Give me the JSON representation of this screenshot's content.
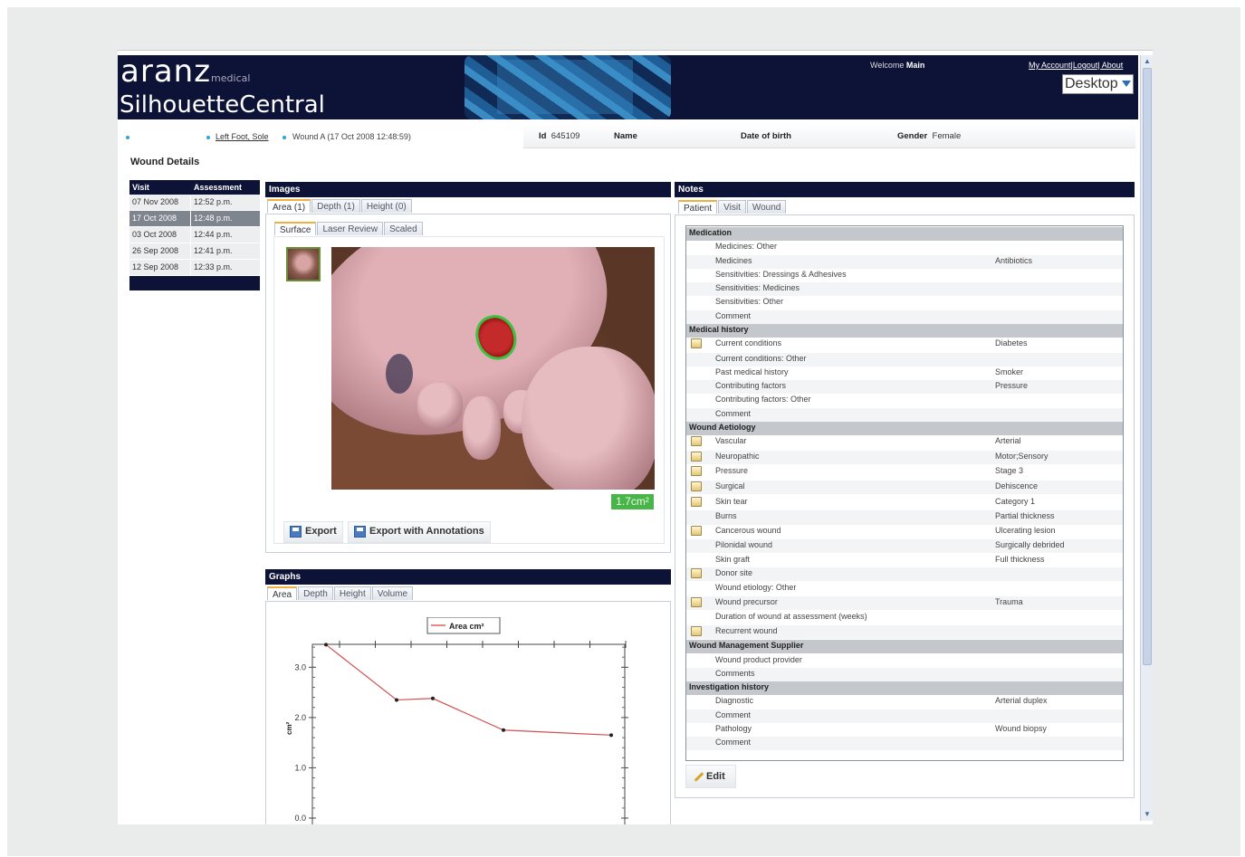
{
  "header": {
    "logo_main": "aranz",
    "logo_sub": "medical",
    "product": "SilhouetteCentral",
    "welcome_prefix": "Welcome",
    "welcome_user": "Main",
    "top_links": "My Account|Logout| About",
    "workspace_select": "Desktop"
  },
  "breadcrumb": {
    "link": "Left Foot, Sole",
    "current": "Wound A (17 Oct 2008 12:48:59)"
  },
  "patient": {
    "id_label": "Id",
    "id_value": "645109",
    "name_label": "Name",
    "name_value": "",
    "dob_label": "Date of birth",
    "dob_value": "",
    "gender_label": "Gender",
    "gender_value": "Female"
  },
  "page_title": "Wound Details",
  "visits": {
    "col_visit": "Visit",
    "col_assessment": "Assessment",
    "rows": [
      {
        "visit": "07 Nov 2008",
        "assessment": "12:52 p.m."
      },
      {
        "visit": "17 Oct 2008",
        "assessment": "12:48 p.m."
      },
      {
        "visit": "03 Oct 2008",
        "assessment": "12:44 p.m."
      },
      {
        "visit": "26 Sep 2008",
        "assessment": "12:41 p.m."
      },
      {
        "visit": "12 Sep 2008",
        "assessment": "12:33 p.m."
      }
    ],
    "selected_index": 1
  },
  "images": {
    "title": "Images",
    "tabs": [
      "Area (1)",
      "Depth (1)",
      "Height (0)"
    ],
    "subtabs": [
      "Surface",
      "Laser Review",
      "Scaled"
    ],
    "area_badge": "1.7cm²",
    "export_label": "Export",
    "export_annotations_label": "Export with Annotations"
  },
  "graphs": {
    "title": "Graphs",
    "tabs": [
      "Area",
      "Depth",
      "Height",
      "Volume"
    ]
  },
  "chart_data": {
    "type": "line",
    "legend": "Area cm²",
    "ylabel": "cm²",
    "x_index": [
      0,
      1,
      2,
      3,
      4
    ],
    "values": [
      3.45,
      2.35,
      2.38,
      1.75,
      1.65
    ],
    "yticks": [
      "0.0",
      "1.0",
      "2.0",
      "3.0"
    ],
    "ylim": [
      0,
      3.6
    ]
  },
  "notes": {
    "title": "Notes",
    "tabs": [
      "Patient",
      "Visit",
      "Wound"
    ],
    "edit_label": "Edit",
    "rows": [
      {
        "section": "Medication"
      },
      {
        "label": "Medicines: Other",
        "value": "",
        "icon": false
      },
      {
        "label": "Medicines",
        "value": "Antibiotics",
        "icon": false
      },
      {
        "label": "Sensitivities: Dressings & Adhesives",
        "value": "",
        "icon": false
      },
      {
        "label": "Sensitivities: Medicines",
        "value": "",
        "icon": false
      },
      {
        "label": "Sensitivities: Other",
        "value": "",
        "icon": false
      },
      {
        "label": "Comment",
        "value": "",
        "icon": false
      },
      {
        "section": "Medical history"
      },
      {
        "label": "Current conditions",
        "value": "Diabetes",
        "icon": true
      },
      {
        "label": "Current conditions: Other",
        "value": "",
        "icon": false
      },
      {
        "label": "Past medical history",
        "value": "Smoker",
        "icon": false
      },
      {
        "label": "Contributing factors",
        "value": "Pressure",
        "icon": false
      },
      {
        "label": "Contributing factors: Other",
        "value": "",
        "icon": false
      },
      {
        "label": "Comment",
        "value": "",
        "icon": false
      },
      {
        "section": "Wound Aetiology"
      },
      {
        "label": "Vascular",
        "value": "Arterial",
        "icon": true
      },
      {
        "label": "Neuropathic",
        "value": "Motor;Sensory",
        "icon": true
      },
      {
        "label": "Pressure",
        "value": "Stage 3",
        "icon": true
      },
      {
        "label": "Surgical",
        "value": "Dehiscence",
        "icon": true
      },
      {
        "label": "Skin tear",
        "value": "Category 1",
        "icon": true
      },
      {
        "label": "Burns",
        "value": "Partial thickness",
        "icon": false
      },
      {
        "label": "Cancerous wound",
        "value": "Ulcerating lesion",
        "icon": true
      },
      {
        "label": "Pilonidal wound",
        "value": "Surgically debrided",
        "icon": false
      },
      {
        "label": "Skin graft",
        "value": "Full thickness",
        "icon": false
      },
      {
        "label": "Donor site",
        "value": "",
        "icon": true
      },
      {
        "label": "Wound etiology: Other",
        "value": "",
        "icon": false
      },
      {
        "label": "Wound precursor",
        "value": "Trauma",
        "icon": true
      },
      {
        "label": "Duration of wound at assessment (weeks)",
        "value": "",
        "icon": false
      },
      {
        "label": "Recurrent wound",
        "value": "",
        "icon": true
      },
      {
        "section": "Wound Management Supplier"
      },
      {
        "label": "Wound product provider",
        "value": "",
        "icon": false
      },
      {
        "label": "Comments",
        "value": "",
        "icon": false
      },
      {
        "section": "Investigation history"
      },
      {
        "label": "Diagnostic",
        "value": "Arterial duplex",
        "icon": false
      },
      {
        "label": "Comment",
        "value": "",
        "icon": false
      },
      {
        "label": "Pathology",
        "value": "Wound biopsy",
        "icon": false
      },
      {
        "label": "Comment",
        "value": "",
        "icon": false
      }
    ]
  }
}
